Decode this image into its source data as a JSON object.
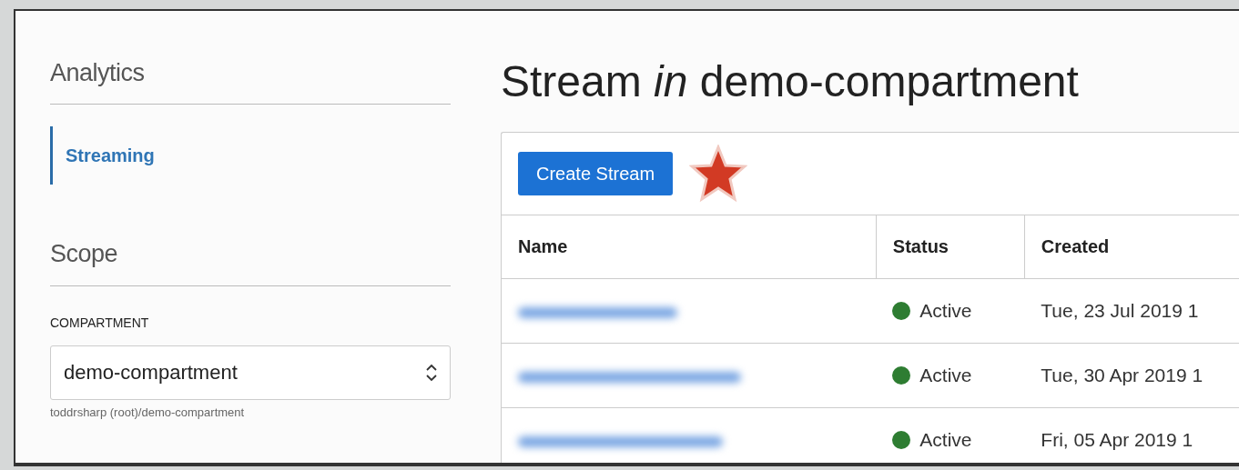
{
  "sidebar": {
    "section_title": "Analytics",
    "items": [
      {
        "label": "Streaming",
        "selected": true
      }
    ],
    "scope_title": "Scope",
    "compartment": {
      "label": "COMPARTMENT",
      "value": "demo-compartment",
      "hint": "toddrsharp (root)/demo-compartment"
    }
  },
  "main": {
    "title": "Stream *in* demo-compartment",
    "create_button": "Create Stream",
    "table": {
      "columns": [
        "Name",
        "Status",
        "Created"
      ],
      "rows": [
        {
          "status": "Active",
          "color": "#2e7d32",
          "created": "Tue, 23 Jul 2019 1"
        },
        {
          "status": "Active",
          "color": "#2e7d32",
          "created": "Tue, 30 Apr 2019 1"
        },
        {
          "status": "Active",
          "color": "#2e7d32",
          "created": "Fri, 05 Apr 2019 1"
        }
      ]
    }
  }
}
